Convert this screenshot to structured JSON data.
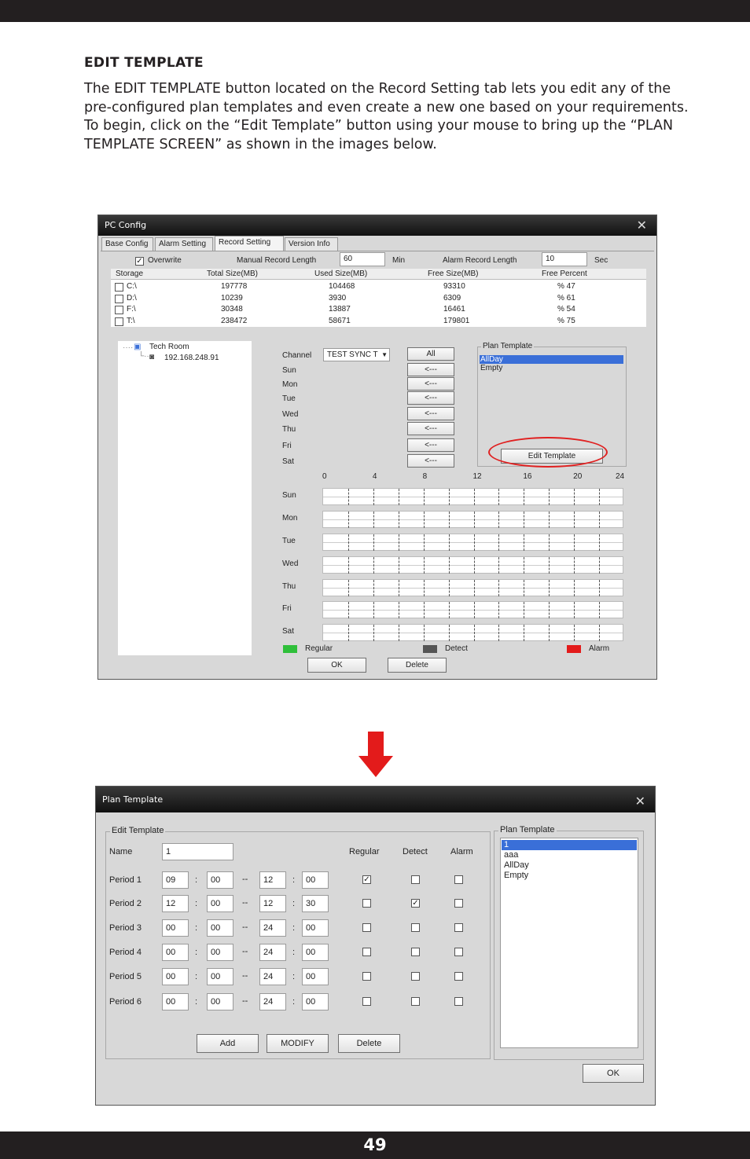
{
  "heading": "EDIT TEMPLATE",
  "paragraph": "The EDIT TEMPLATE button located on the Record Setting tab lets you edit any of the pre-configured plan templates and even create a new one based on your requirements. To begin, click on the “Edit Template” button using your mouse to bring up the “PLAN TEMPLATE SCREEN” as shown in the images below.",
  "page_number": "49",
  "colors": {
    "regular": "#2fbf3a",
    "detect": "#555555",
    "alarm": "#e31b1b",
    "arrow": "#e31b1b",
    "highlight": "#e02020"
  },
  "pc_config": {
    "title": "PC Config",
    "tabs": [
      "Base Config",
      "Alarm Setting",
      "Record Setting",
      "Version Info"
    ],
    "active_tab": "Record Setting",
    "overwrite_label": "Overwrite",
    "overwrite_checked": true,
    "manual_record_label": "Manual Record Length",
    "manual_record_value": "60",
    "min_unit": "Min",
    "alarm_record_label": "Alarm Record Length",
    "alarm_record_value": "10",
    "sec_unit": "Sec",
    "storage_headers": [
      "Storage",
      "Total Size(MB)",
      "Used Size(MB)",
      "Free Size(MB)",
      "Free Percent"
    ],
    "storage_rows": [
      {
        "drive": "C:\\",
        "total": "197778",
        "used": "104468",
        "free": "93310",
        "percent": "% 47"
      },
      {
        "drive": "D:\\",
        "total": "10239",
        "used": "3930",
        "free": "6309",
        "percent": "% 61"
      },
      {
        "drive": "F:\\",
        "total": "30348",
        "used": "13887",
        "free": "16461",
        "percent": "% 54"
      },
      {
        "drive": "T:\\",
        "total": "238472",
        "used": "58671",
        "free": "179801",
        "percent": "% 75"
      }
    ],
    "tree_root": "Tech Room",
    "tree_child": "192.168.248.91",
    "channel_label": "Channel",
    "channel_value": "TEST SYNC T",
    "all_button": "All",
    "days": [
      "Sun",
      "Mon",
      "Tue",
      "Wed",
      "Thu",
      "Fri",
      "Sat"
    ],
    "arrow_button": "<---",
    "plan_template_group": "Plan Template",
    "plan_templates": [
      "AllDay",
      "Empty"
    ],
    "selected_template": "AllDay",
    "edit_template_button": "Edit Template",
    "hour_labels": [
      "0",
      "4",
      "8",
      "12",
      "16",
      "20",
      "24"
    ],
    "legend": [
      "Regular",
      "Detect",
      "Alarm"
    ],
    "ok_button": "OK",
    "delete_button": "Delete"
  },
  "plan_template": {
    "title": "Plan Template",
    "edit_group": "Edit Template",
    "name_label": "Name",
    "name_value": "1",
    "col_regular": "Regular",
    "col_detect": "Detect",
    "col_alarm": "Alarm",
    "periods": [
      {
        "label": "Period 1",
        "start_h": "09",
        "start_m": "00",
        "end_h": "12",
        "end_m": "00",
        "regular": true,
        "detect": false,
        "alarm": false
      },
      {
        "label": "Period 2",
        "start_h": "12",
        "start_m": "00",
        "end_h": "12",
        "end_m": "30",
        "regular": false,
        "detect": true,
        "alarm": false
      },
      {
        "label": "Period 3",
        "start_h": "00",
        "start_m": "00",
        "end_h": "24",
        "end_m": "00",
        "regular": false,
        "detect": false,
        "alarm": false
      },
      {
        "label": "Period 4",
        "start_h": "00",
        "start_m": "00",
        "end_h": "24",
        "end_m": "00",
        "regular": false,
        "detect": false,
        "alarm": false
      },
      {
        "label": "Period 5",
        "start_h": "00",
        "start_m": "00",
        "end_h": "24",
        "end_m": "00",
        "regular": false,
        "detect": false,
        "alarm": false
      },
      {
        "label": "Period 6",
        "start_h": "00",
        "start_m": "00",
        "end_h": "24",
        "end_m": "00",
        "regular": false,
        "detect": false,
        "alarm": false
      }
    ],
    "colon": ":",
    "dash": "--",
    "add_button": "Add",
    "modify_button": "MODIFY",
    "delete_button": "Delete",
    "list_group": "Plan Template",
    "list_items": [
      "1",
      "aaa",
      "AllDay",
      "Empty"
    ],
    "selected_item": "1",
    "ok_button": "OK"
  }
}
